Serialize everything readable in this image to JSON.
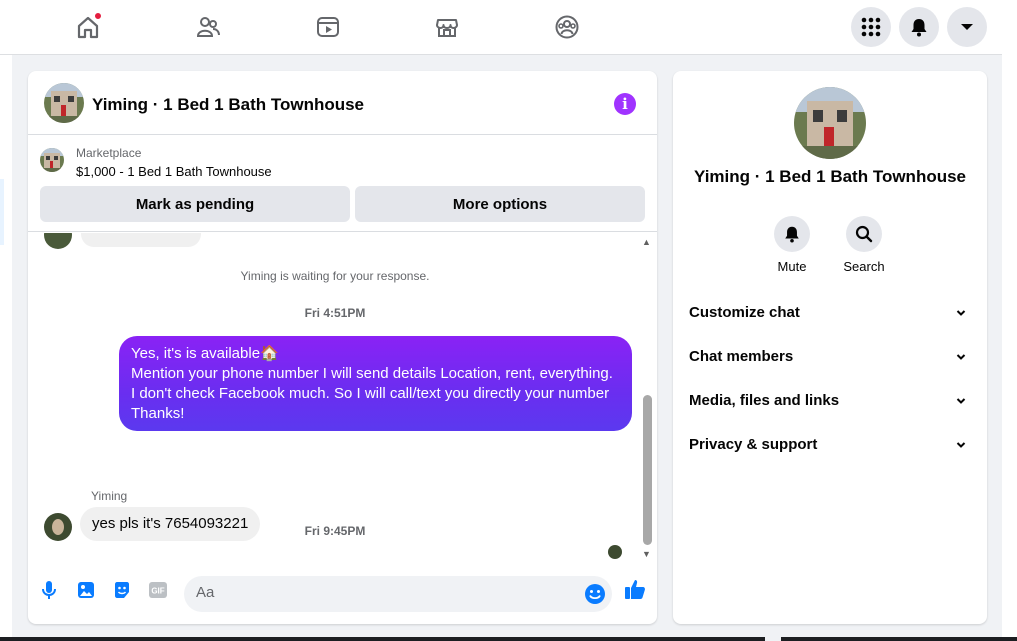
{
  "nav": {
    "icons": [
      "home-icon",
      "friends-icon",
      "watch-icon",
      "marketplace-icon",
      "groups-icon"
    ],
    "right_icons": [
      "menu-grid-icon",
      "notifications-bell-icon",
      "account-caret-icon"
    ],
    "home_has_notification": true
  },
  "chat": {
    "title": "Yiming · 1 Bed 1 Bath Townhouse",
    "marketplace": {
      "label": "Marketplace",
      "item": "$1,000 - 1 Bed 1 Bath Townhouse",
      "mark_pending": "Mark as pending",
      "more_options": "More options"
    },
    "system_note": "Yiming is waiting for your response.",
    "time_1": "Fri 4:51PM",
    "outgoing_message": {
      "line1": "Yes, it's is available🏠",
      "line2": "Mention your phone number I will send details Location, rent, everything.",
      "line3": "I don't check Facebook much. So I will call/text you directly your number",
      "line4": "Thanks!"
    },
    "time_2": "Fri 9:45PM",
    "sender": "Yiming",
    "incoming_message": "yes pls it's 7654093221",
    "composer": {
      "placeholder": "Aa",
      "icons": [
        "microphone-icon",
        "photo-icon",
        "sticker-icon",
        "gif-icon",
        "emoji-icon",
        "thumbs-up-icon"
      ]
    }
  },
  "side": {
    "name": "Yiming · 1 Bed 1 Bath Townhouse",
    "actions": [
      {
        "label": "Mute",
        "icon": "bell-icon"
      },
      {
        "label": "Search",
        "icon": "search-icon"
      }
    ],
    "sections": [
      {
        "label": "Customize chat"
      },
      {
        "label": "Chat members"
      },
      {
        "label": "Media, files and links"
      },
      {
        "label": "Privacy & support"
      }
    ]
  },
  "colors": {
    "accent": "#a033ff",
    "bubble_top": "#8a22f5",
    "bubble_bottom": "#5b39ef",
    "composer_icon": "#0a7cff"
  }
}
